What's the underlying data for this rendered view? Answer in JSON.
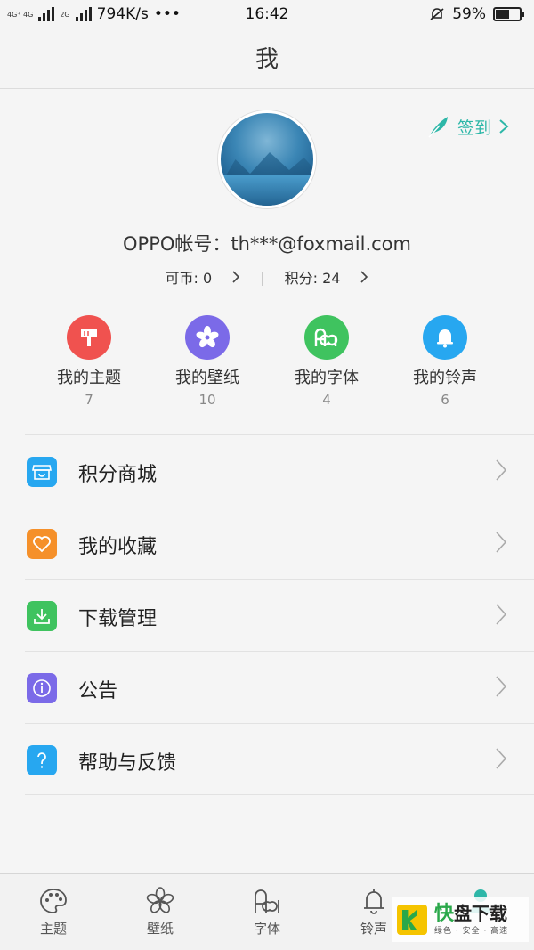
{
  "status_bar": {
    "network_top": "4G⁺ 4G",
    "network_bottom": "2G",
    "speed": "794K/s",
    "more": "•••",
    "time": "16:42",
    "battery": "59%",
    "battery_level": 0.59
  },
  "header": {
    "title": "我"
  },
  "profile": {
    "checkin_label": "签到",
    "account": "OPPO帐号：th***@foxmail.com",
    "coins_label": "可币: 0",
    "points_label": "积分: 24"
  },
  "quick_items": [
    {
      "label": "我的主题",
      "count": "7",
      "icon": "theme-brush-icon",
      "color": "#f0524f"
    },
    {
      "label": "我的壁纸",
      "count": "10",
      "icon": "wallpaper-flower-icon",
      "color": "#7b6ae8"
    },
    {
      "label": "我的字体",
      "count": "4",
      "icon": "font-aa-icon",
      "color": "#3fc35f"
    },
    {
      "label": "我的铃声",
      "count": "6",
      "icon": "ringtone-bell-icon",
      "color": "#27a7f0"
    }
  ],
  "menu": [
    {
      "label": "积分商城",
      "icon": "store-icon",
      "color": "#27a7f0"
    },
    {
      "label": "我的收藏",
      "icon": "heart-icon",
      "color": "#f5902a"
    },
    {
      "label": "下载管理",
      "icon": "download-icon",
      "color": "#3fc35f"
    },
    {
      "label": "公告",
      "icon": "info-icon",
      "color": "#7b6ae8"
    },
    {
      "label": "帮助与反馈",
      "icon": "help-icon",
      "color": "#27a7f0"
    }
  ],
  "bottom_nav": [
    {
      "label": "主题",
      "icon": "palette-icon"
    },
    {
      "label": "壁纸",
      "icon": "flower-icon"
    },
    {
      "label": "字体",
      "icon": "aa-icon"
    },
    {
      "label": "铃声",
      "icon": "bell-icon"
    }
  ],
  "watermark": {
    "kuai": "快",
    "brand": "盘下载",
    "tagline": "绿色 · 安全 · 高速"
  },
  "colors": {
    "accent": "#2db7a8",
    "selected_tab": "#2db7a8"
  }
}
